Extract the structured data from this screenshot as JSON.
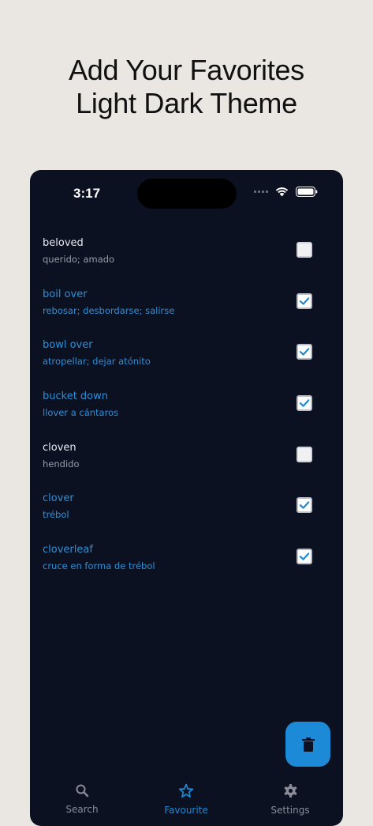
{
  "promo": {
    "line1": "Add Your Favorites",
    "line2": "Light Dark Theme"
  },
  "status_bar": {
    "time": "3:17",
    "icons": [
      "signal-icon",
      "wifi-icon",
      "battery-icon"
    ]
  },
  "favorites": [
    {
      "word": "beloved",
      "translation": "querido; amado",
      "checked": false
    },
    {
      "word": "boil over",
      "translation": "rebosar; desbordarse; salirse",
      "checked": true
    },
    {
      "word": "bowl over",
      "translation": "atropellar; dejar atónito",
      "checked": true
    },
    {
      "word": "bucket down",
      "translation": "llover a cántaros",
      "checked": true
    },
    {
      "word": "cloven",
      "translation": "hendido",
      "checked": false
    },
    {
      "word": "clover",
      "translation": "trébol",
      "checked": true
    },
    {
      "word": "cloverleaf",
      "translation": "cruce en forma de trébol",
      "checked": true
    }
  ],
  "fab": {
    "icon": "trash-icon"
  },
  "tabs": [
    {
      "label": "Search",
      "icon": "search-icon",
      "active": false
    },
    {
      "label": "Favourite",
      "icon": "star-icon",
      "active": true
    },
    {
      "label": "Settings",
      "icon": "gear-icon",
      "active": false
    }
  ],
  "colors": {
    "background": "#eae7e3",
    "app_background": "#0c1122",
    "accent": "#1c8ad6",
    "favorite_text": "#2e8fd6"
  }
}
